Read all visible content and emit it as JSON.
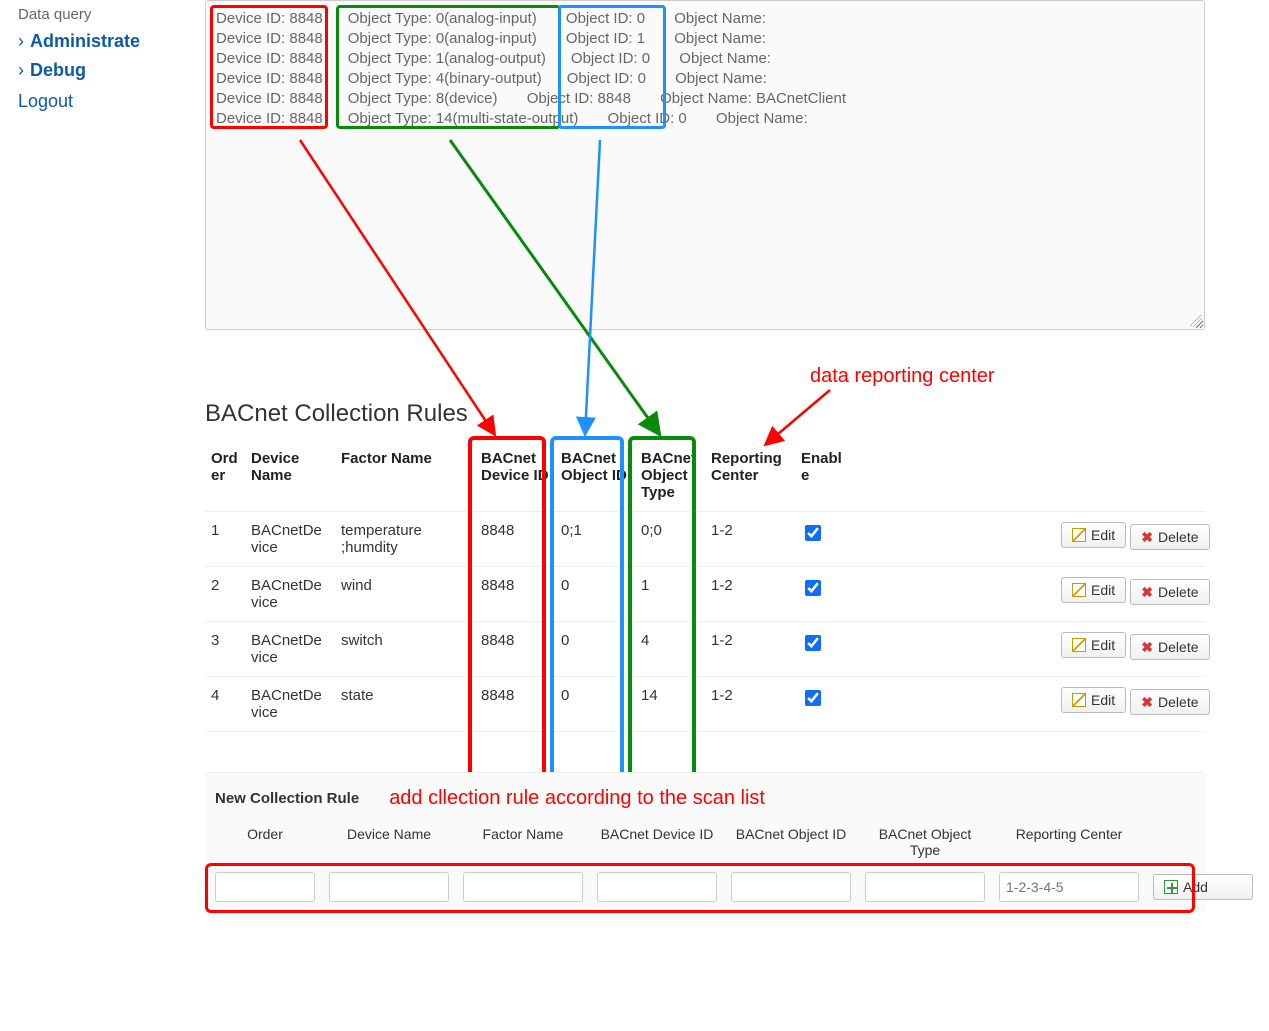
{
  "sidebar": {
    "data_query": "Data query",
    "administrate": "Administrate",
    "debug": "Debug",
    "logout": "Logout"
  },
  "scan_lines": [
    "Device ID: 8848      Object Type: 0(analog-input)       Object ID: 0       Object Name:",
    "Device ID: 8848      Object Type: 0(analog-input)       Object ID: 1       Object Name:",
    "Device ID: 8848      Object Type: 1(analog-output)      Object ID: 0       Object Name:",
    "Device ID: 8848      Object Type: 4(binary-output)      Object ID: 0       Object Name:",
    "Device ID: 8848      Object Type: 8(device)       Object ID: 8848       Object Name: BACnetClient",
    "Device ID: 8848      Object Type: 14(multi-state-output)       Object ID: 0       Object Name:"
  ],
  "section_title": "BACnet Collection Rules",
  "table": {
    "headers": {
      "order": "Order",
      "device_name": "Device Name",
      "factor_name": "Factor Name",
      "bacnet_device_id": "BACnet Device ID",
      "bacnet_object_id": "BACnet Object ID",
      "bacnet_object_type": "BACnet Object Type",
      "reporting_center": "Reporting Center",
      "enable": "Enable"
    },
    "rows": [
      {
        "order": "1",
        "device_name": "BACnetDevice",
        "factor_name": "temperature ;humdity",
        "bacnet_device_id": "8848",
        "bacnet_object_id": "0;1",
        "bacnet_object_type": "0;0",
        "reporting_center": "1-2",
        "enable": true
      },
      {
        "order": "2",
        "device_name": "BACnetDevice",
        "factor_name": "wind",
        "bacnet_device_id": "8848",
        "bacnet_object_id": "0",
        "bacnet_object_type": "1",
        "reporting_center": "1-2",
        "enable": true
      },
      {
        "order": "3",
        "device_name": "BACnetDevice",
        "factor_name": "switch",
        "bacnet_device_id": "8848",
        "bacnet_object_id": "0",
        "bacnet_object_type": "4",
        "reporting_center": "1-2",
        "enable": true
      },
      {
        "order": "4",
        "device_name": "BACnetDevice",
        "factor_name": "state",
        "bacnet_device_id": "8848",
        "bacnet_object_id": "0",
        "bacnet_object_type": "14",
        "reporting_center": "1-2",
        "enable": true
      }
    ],
    "edit_label": "Edit",
    "delete_label": "Delete"
  },
  "new_rule": {
    "title": "New Collection Rule",
    "annotation": "add cllection rule according to the scan list",
    "headers": {
      "order": "Order",
      "device_name": "Device Name",
      "factor_name": "Factor Name",
      "bacnet_device_id": "BACnet Device ID",
      "bacnet_object_id": "BACnet Object ID",
      "bacnet_object_type": "BACnet Object Type",
      "reporting_center": "Reporting Center"
    },
    "placeholder_reporting": "1-2-3-4-5",
    "add_label": "Add"
  },
  "annotations": {
    "reporting": "data reporting center"
  }
}
